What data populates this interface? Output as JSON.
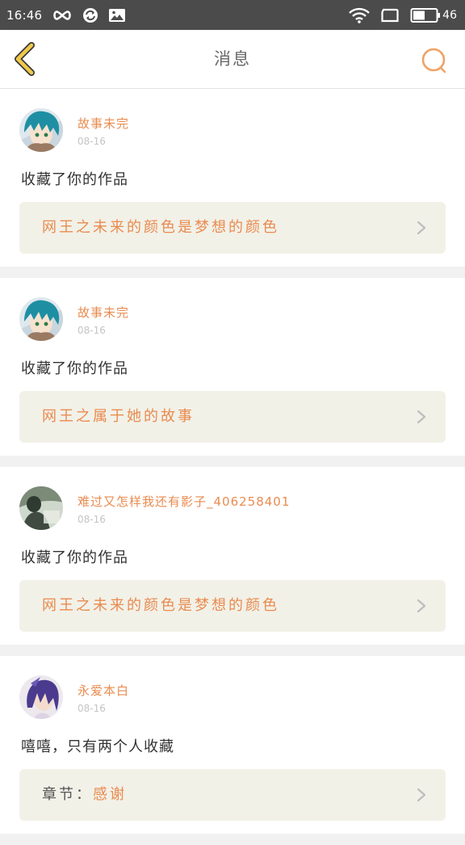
{
  "status_bar": {
    "time": "16:46",
    "battery_level": "46"
  },
  "header": {
    "title": "消息"
  },
  "items": [
    {
      "username": "故事未完",
      "date": "08-16",
      "action": "收藏了你的作品",
      "work_prefix": "",
      "work_title": "网王之未来的颜色是梦想的颜色",
      "avatar_icon": "avatar-blue-hair"
    },
    {
      "username": "故事未完",
      "date": "08-16",
      "action": "收藏了你的作品",
      "work_prefix": "",
      "work_title": "网王之属于她的故事",
      "avatar_icon": "avatar-blue-hair"
    },
    {
      "username": "难过又怎样我还有影子_406258401",
      "date": "08-16",
      "action": "收藏了你的作品",
      "work_prefix": "",
      "work_title": "网王之未来的颜色是梦想的颜色",
      "avatar_icon": "avatar-photo"
    },
    {
      "username": "永爱本白",
      "date": "08-16",
      "action": "嘻嘻，只有两个人收藏",
      "work_prefix": "章节：",
      "work_title": "感谢",
      "avatar_icon": "avatar-purple-hair"
    }
  ],
  "colors": {
    "accent": "#e98b4f",
    "status_bar_bg": "#4b4b4b",
    "back_arrow": "#f0c94a",
    "work_box_bg": "#f2f1e8"
  }
}
